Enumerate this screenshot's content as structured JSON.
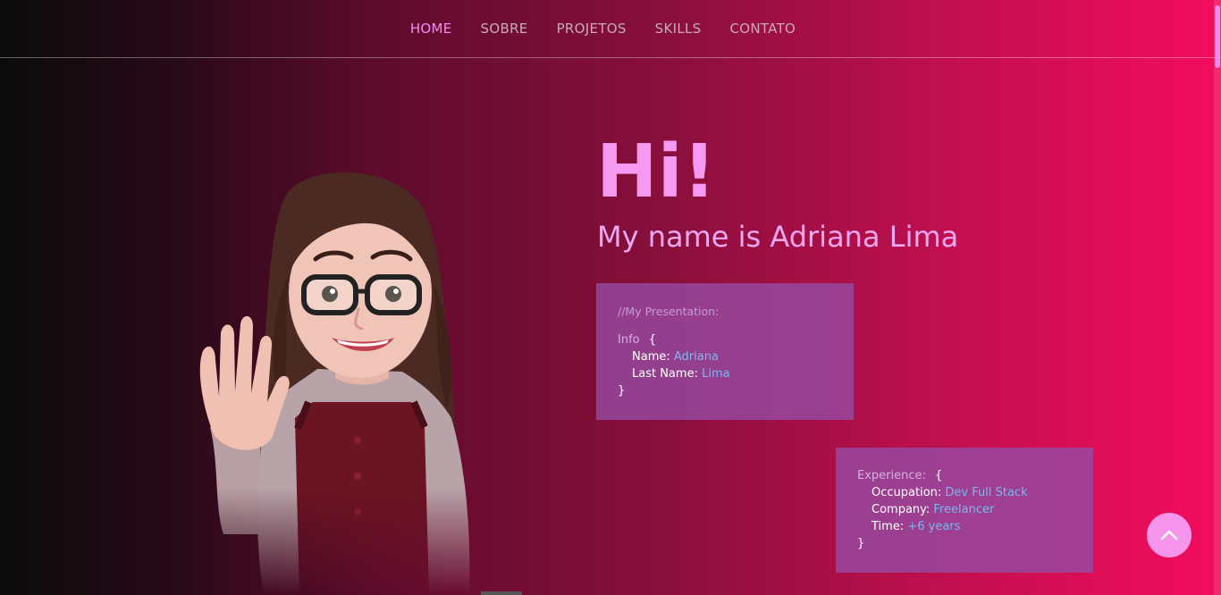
{
  "nav": {
    "items": [
      {
        "label": "HOME",
        "active": true
      },
      {
        "label": "SOBRE",
        "active": false
      },
      {
        "label": "PROJETOS",
        "active": false
      },
      {
        "label": "SKILLS",
        "active": false
      },
      {
        "label": "CONTATO",
        "active": false
      }
    ]
  },
  "hero": {
    "greeting": "Hi!",
    "subtitle": "My name is Adriana Lima"
  },
  "presentation": {
    "comment": "//My Presentation:",
    "key": "Info",
    "open": "{",
    "close": "}",
    "fields": [
      {
        "label": "Name:",
        "value": "Adriana"
      },
      {
        "label": "Last Name:",
        "value": "Lima"
      }
    ]
  },
  "experience": {
    "key": "Experience:",
    "open": "{",
    "close": "}",
    "fields": [
      {
        "label": "Occupation:",
        "value": "Dev Full Stack"
      },
      {
        "label": "Company:",
        "value": "Freelancer"
      },
      {
        "label": "Time:",
        "value": "+6 years"
      }
    ]
  },
  "icons": {
    "scroll_top": "chevron-up-icon",
    "avatar": "avatar-waving-illustration"
  },
  "colors": {
    "accent": "#f59af0",
    "card": "#9a4ba6",
    "value": "#7ab8f0"
  }
}
